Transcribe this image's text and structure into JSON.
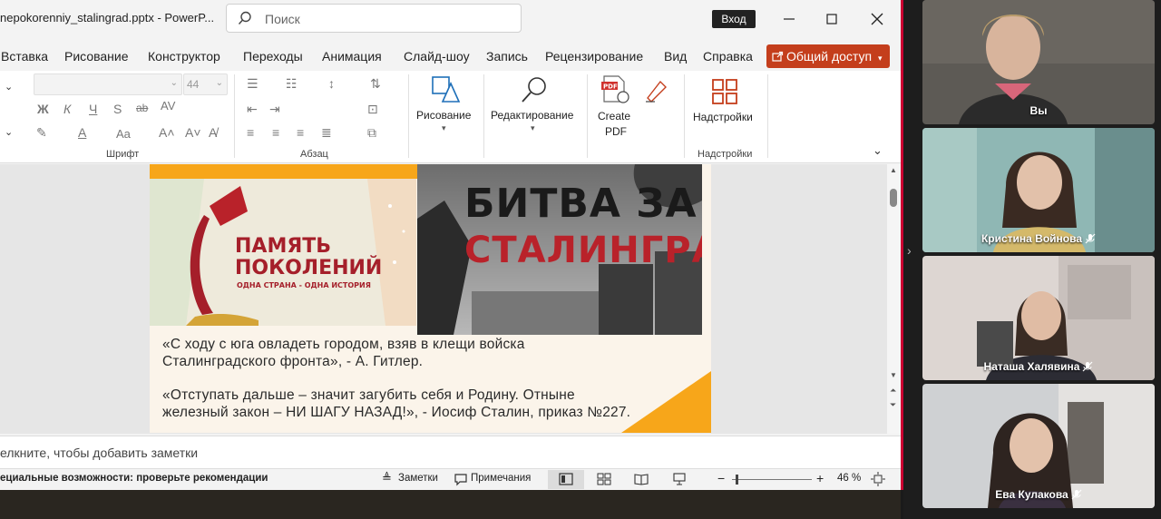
{
  "window": {
    "title": "nepokorenniy_stalingrad.pptx  -  PowerP...",
    "search_placeholder": "Поиск",
    "signin_label": "Вход"
  },
  "menu": {
    "items": [
      "Вставка",
      "Рисование",
      "Конструктор",
      "Переходы",
      "Анимация",
      "Слайд-шоу",
      "Запись",
      "Рецензирование",
      "Вид",
      "Справка"
    ],
    "share_label": "Общий доступ"
  },
  "ribbon": {
    "font_size_value": "44",
    "font_group_label": "Шрифт",
    "paragraph_group_label": "Абзац",
    "drawing_label": "Рисование",
    "editing_label": "Редактирование",
    "create_pdf_label_1": "Create",
    "create_pdf_label_2": "PDF",
    "addins_label": "Надстройки",
    "addins_group_label": "Надстройки"
  },
  "slide": {
    "logo_line1": "ПАМЯТЬ",
    "logo_line2": "ПОКОЛЕНИЙ",
    "logo_line3": "ОДНА СТРАНА - ОДНА ИСТОРИЯ",
    "photo_title_line1": "БИТВА ЗА",
    "photo_title_line2": "СТАЛИНГРАД",
    "quote1_line1": "«С ходу с юга овладеть городом, взяв в клещи войска",
    "quote1_line2": "Сталинградского фронта», - А. Гитлер.",
    "quote2_line1": "«Отступать дальше – значит загубить себя и Родину. Отныне",
    "quote2_line2": "железный закон – НИ ШАГУ НАЗАД!», - Иосиф Сталин, приказ №227."
  },
  "notes": {
    "placeholder": "елкните, чтобы добавить заметки"
  },
  "status": {
    "accessibility": "ециальные возможности: проверьте рекомендации",
    "notes_label": "Заметки",
    "comments_label": "Примечания",
    "zoom": "46 %"
  },
  "participants": [
    {
      "name": "Вы",
      "muted": false
    },
    {
      "name": "Кристина Войнова",
      "muted": true
    },
    {
      "name": "Наташа Халявина",
      "muted": true
    },
    {
      "name": "Ева Кулакова",
      "muted": true
    }
  ],
  "colors": {
    "share_button": "#c43e1c",
    "slide_accent": "#f7a61a",
    "slide_red": "#b9222a",
    "window_border": "#cc0033"
  }
}
